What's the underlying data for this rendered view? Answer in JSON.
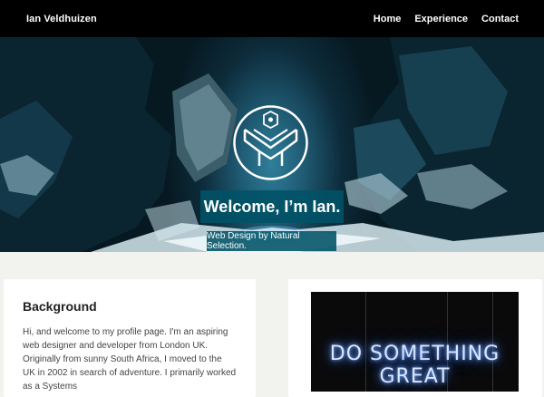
{
  "nav": {
    "brand": "Ian Veldhuizen",
    "links": [
      "Home",
      "Experience",
      "Contact"
    ]
  },
  "hero": {
    "title": "Welcome, I’m Ian.",
    "subtitle": "Web Design by Natural Selection."
  },
  "background_card": {
    "title": "Background",
    "text": "Hi, and welcome to my profile page. I'm an aspiring web designer and developer from London UK. Originally from sunny South Africa, I moved to the UK in 2002 in search of adventure. I primarily worked as a Systems"
  },
  "image_card": {
    "neon_text": "DO SOMETHING GREAT"
  },
  "colors": {
    "navbar": "#000000",
    "hero_label_bg": "#005266",
    "page_bg": "#f2f2ee"
  }
}
